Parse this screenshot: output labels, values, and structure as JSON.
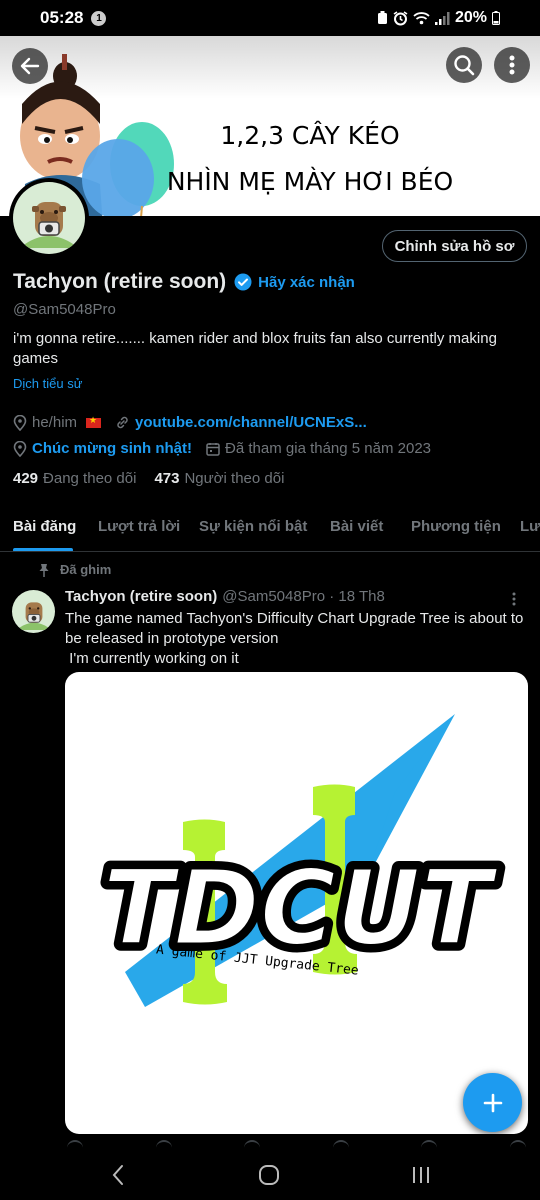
{
  "status_bar": {
    "time": "05:28",
    "notification_count": "1",
    "battery": "20%"
  },
  "banner": {
    "line1": "1,2,3 CÂY KÉO",
    "line2": "NHÌN MẸ MÀY HƠI BÉO"
  },
  "profile": {
    "edit_label": "Chỉnh sửa hồ sơ",
    "display_name": "Tachyon (retire soon)",
    "verify_label": "Hãy xác nhận",
    "handle": "@Sam5048Pro",
    "bio": "i'm gonna retire....... kamen rider and blox fruits fan also currently making games",
    "translate_label": "Dịch tiểu sử",
    "pronouns": "he/him",
    "website": "youtube.com/channel/UCNExS...",
    "birthday": "Chúc mừng sinh nhật!",
    "joined": "Đã tham gia tháng 5 năm 2023",
    "following_count": "429",
    "following_label": "Đang theo dõi",
    "followers_count": "473",
    "followers_label": "Người theo dõi"
  },
  "tabs": [
    {
      "label": "Bài đăng",
      "active": true
    },
    {
      "label": "Lượt trả lời"
    },
    {
      "label": "Sự kiện nổi bật"
    },
    {
      "label": "Bài viết"
    },
    {
      "label": "Phương tiện"
    },
    {
      "label": "Lượt thích"
    }
  ],
  "pinned_post": {
    "pinned_label": "Đã ghim",
    "author_name": "Tachyon (retire soon)",
    "author_meta": "@Sam5048Pro · 18 Th8",
    "text_line1": "The game named Tachyon's Difficulty Chart Upgrade Tree is about to be released in prototype version",
    "text_line2": " I'm currently working on it",
    "media": {
      "logo_text": "TDCUT",
      "tagline": "A game of JJT Upgrade Tree",
      "colors": {
        "blue": "#29a8ea",
        "green": "#b6f233",
        "black": "#000000"
      }
    }
  },
  "colors": {
    "accent": "#1d9bf0",
    "background": "#000000",
    "secondary_text": "#71767b"
  }
}
